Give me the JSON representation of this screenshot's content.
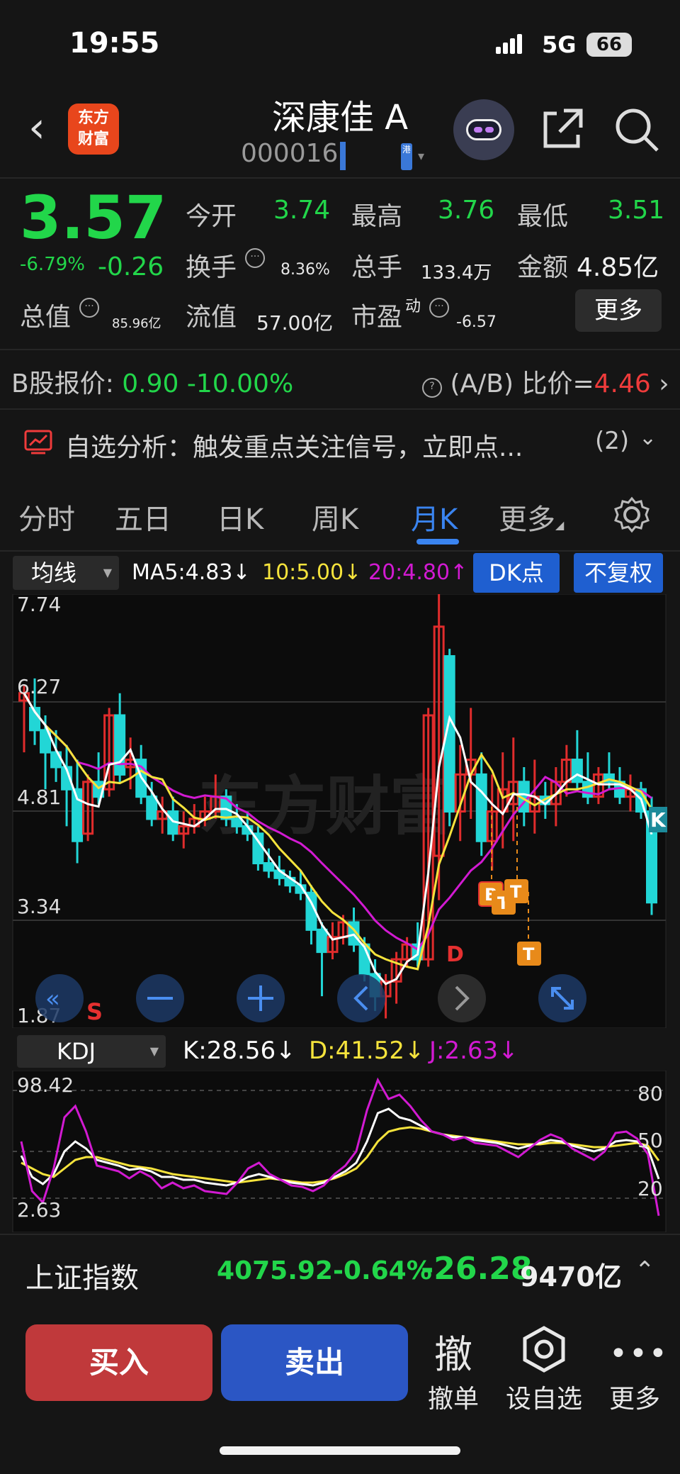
{
  "status_bar": {
    "time": "19:55",
    "network": "5G",
    "battery": "66"
  },
  "header": {
    "title": "深康佳 A",
    "code": "000016",
    "logo_text": "东方\n财富",
    "hk_badge": "港"
  },
  "quote": {
    "price": "3.57",
    "change_pct": "-6.79%",
    "change_abs": "-0.26",
    "open_label": "今开",
    "open": "3.74",
    "high_label": "最高",
    "high": "3.76",
    "low_label": "最低",
    "low": "3.51",
    "turnover_label": "换手",
    "turnover": "8.36%",
    "volume_label": "总手",
    "volume": "133.4万",
    "amount_label": "金额",
    "amount": "4.85亿",
    "total_mv_label": "总值",
    "total_mv": "85.96亿",
    "float_mv_label": "流值",
    "float_mv": "57.00亿",
    "pe_label": "市盈",
    "pe_super": "动",
    "pe": "-6.57",
    "more_label": "更多"
  },
  "bshare": {
    "label": "B股报价:",
    "price": "0.90",
    "change": "-10.00%",
    "ratio_label": "(A/B) 比价=",
    "ratio": "4.46"
  },
  "analysis": {
    "text": "自选分析：触发重点关注信号，立即点...",
    "count": "(2)"
  },
  "tabs": [
    {
      "label": "分时",
      "active": false
    },
    {
      "label": "五日",
      "active": false
    },
    {
      "label": "日K",
      "active": false
    },
    {
      "label": "周K",
      "active": false
    },
    {
      "label": "月K",
      "active": true
    },
    {
      "label": "更多",
      "active": false
    }
  ],
  "ma": {
    "select_label": "均线",
    "ma5": "MA5:4.83",
    "ma10": "10:5.00",
    "ma20": "20:4.80",
    "dk_label": "DK点",
    "adjust_label": "不复权"
  },
  "main_chart": {
    "axis_labels": [
      "7.74",
      "6.27",
      "4.81",
      "3.34",
      "1.87"
    ],
    "markers": [
      "S",
      "D",
      "K",
      "B",
      "T"
    ]
  },
  "kdj": {
    "select_label": "KDJ",
    "k": "K:28.56",
    "d": "D:41.52",
    "j": "J:2.63",
    "left_labels": [
      "98.42",
      "2.63"
    ],
    "right_labels": [
      "80",
      "50",
      "20"
    ]
  },
  "index": {
    "name": "上证指数",
    "value": "4075.92",
    "pct": "-0.64%",
    "change": "-26.28",
    "amount": "9470亿"
  },
  "actions": {
    "buy": "买入",
    "sell": "卖出",
    "cancel_icon": "撤",
    "cancel_label": "撤单",
    "watch_label": "设自选",
    "more_label": "更多"
  },
  "colors": {
    "up": "#e02c2c",
    "down": "#22d6d6",
    "green": "#22d64a",
    "ma5": "#ffffff",
    "ma10": "#f5e33c",
    "ma20": "#d21ad2",
    "accent": "#3a84f0"
  }
}
